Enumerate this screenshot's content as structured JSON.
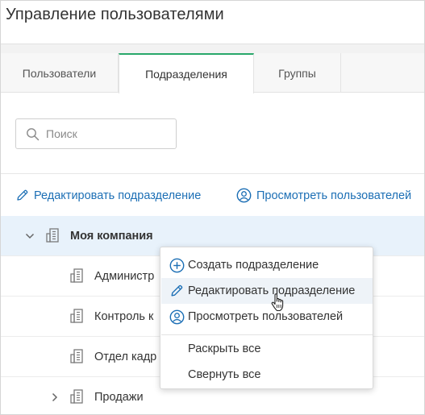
{
  "window": {
    "title": "Управление пользователями"
  },
  "tabs": [
    {
      "label": "Пользователи",
      "active": false
    },
    {
      "label": "Подразделения",
      "active": true
    },
    {
      "label": "Группы",
      "active": false
    }
  ],
  "search": {
    "placeholder": "Поиск",
    "value": ""
  },
  "toolbar": {
    "edit_label": "Редактировать подразделение",
    "view_users_label": "Просмотреть пользователей"
  },
  "tree": {
    "root": {
      "label": "Моя компания",
      "expanded": true,
      "selected": true
    },
    "children": [
      {
        "label": "Администр"
      },
      {
        "label": "Контроль к"
      },
      {
        "label": "Отдел кадр"
      },
      {
        "label": "Продажи",
        "expandable": true
      }
    ]
  },
  "context_menu": {
    "items": [
      {
        "label": "Создать подразделение",
        "icon": "plus-circle-icon"
      },
      {
        "label": "Редактировать подразделение",
        "icon": "pencil-icon",
        "hovered": true
      },
      {
        "label": "Просмотреть пользователей",
        "icon": "user-circle-icon"
      },
      {
        "label": "Раскрыть все"
      },
      {
        "label": "Свернуть все"
      }
    ]
  },
  "colors": {
    "accent": "#1c6fb5",
    "tab_active": "#29a86a",
    "selected_row": "#e8f2fb",
    "icon_gray": "#7a7a7a"
  }
}
